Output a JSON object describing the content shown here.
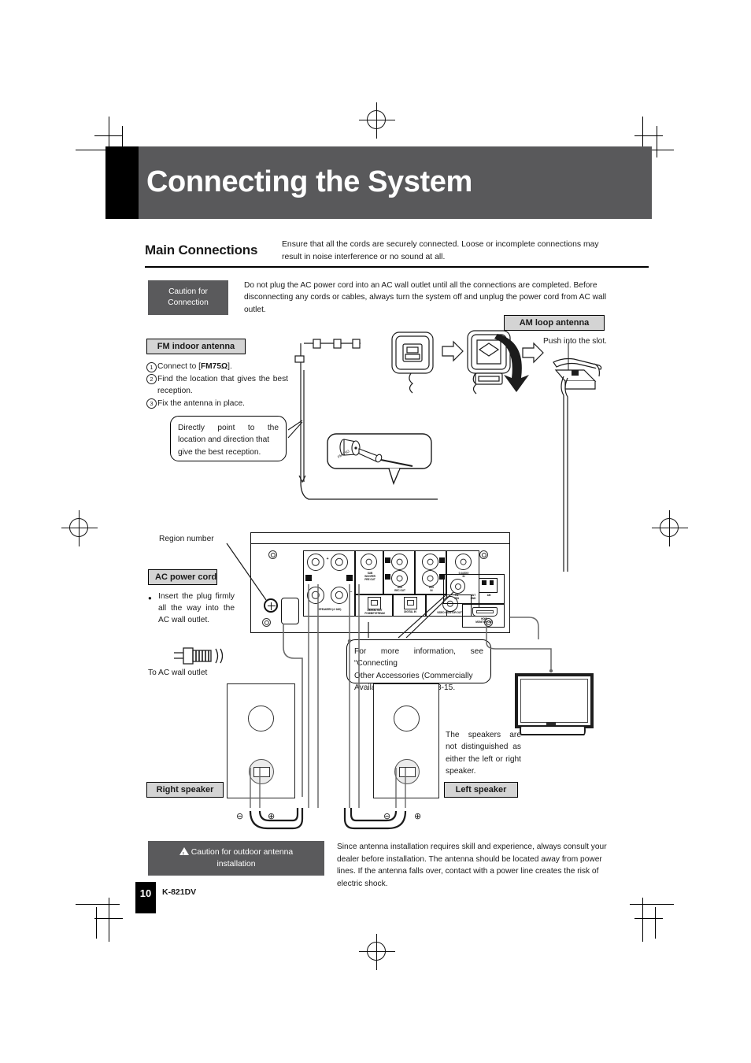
{
  "header": {
    "title": "Connecting the System"
  },
  "main_connections": {
    "heading": "Main Connections",
    "intro": "Ensure that all the cords are securely connected. Loose or incomplete connections may result in noise interference or no sound at all."
  },
  "caution_connection": {
    "label_line1": "Caution for",
    "label_line2": "Connection",
    "text": "Do not plug the AC power cord into an AC wall outlet until all the connections are completed. Before disconnecting any cords or cables, always turn the system off and unplug the power cord from AC wall outlet."
  },
  "fm_antenna": {
    "chip": "FM indoor antenna",
    "step1_pre": "Connect to [",
    "step1_bold": "FM75Ω",
    "step1_post": "].",
    "step2": "Find the location that gives the best reception.",
    "step3": "Fix the antenna in place.",
    "callout_line1": "Directly point to the",
    "callout_line2": "location and direction that",
    "callout_line3": "give the best reception.",
    "connector_label": "FM 75Ω"
  },
  "am_antenna": {
    "chip": "AM loop antenna",
    "push_note": "Push into the slot."
  },
  "ac_power": {
    "region_label": "Region number",
    "chip": "AC power cord",
    "note": "Insert the plug firmly all the way into the AC wall outlet.",
    "outlet_label": "To AC wall outlet"
  },
  "info_callout": {
    "line1": "For more information, see “Connecting",
    "line2": "Other Accessories (Commercially",
    "line3": "Available Units)” on P.13-15."
  },
  "speakers": {
    "right_chip": "Right speaker",
    "left_chip": "Left speaker",
    "note": "The speakers are not distinguished as either the left or right speaker.",
    "minus": "⊖",
    "plus": "⊕"
  },
  "rear_panel": {
    "labels": {
      "speakers": "SPEAKERS (4~16Ω)",
      "subwoofer_l1": "SUB",
      "subwoofer_l2": "WOOFER",
      "subwoofer_l3": "PRE OUT",
      "aux_rec_l1": "AUX",
      "aux_rec_l2": "REC OUT",
      "aux_in_l1": "AUX",
      "aux_in_l2": "IN",
      "d_audio_l1": "D.AUDIO",
      "d_audio_l2": "IN",
      "digital_out_l1": "DIGITAL OUT",
      "digital_out_l2": "PCM/BITSTREAM",
      "digital_in": "DIGITAL IN",
      "video_monitor_out": "VIDEO MONITOR OUT",
      "fm_l1": "FM",
      "fm_l2": "75Ω",
      "ant_gnd_l1": "ANT",
      "ant_gnd_l2": "GND",
      "am": "AM",
      "hdmi_l1": "HDMI",
      "hdmi_l2": "MONITOR OUT",
      "ch_r": "R",
      "ch_l": "L",
      "plus": "+",
      "minus": "−"
    }
  },
  "caution_outdoor": {
    "label_line1": "Caution for outdoor antenna",
    "label_line2": "installation",
    "text": "Since antenna installation requires skill and experience, always consult your dealer before installation. The antenna should be located away from power lines. If the antenna falls over, contact with a power line creates the risk of electric shock."
  },
  "footer": {
    "page_number": "10",
    "model": "K-821DV"
  },
  "colors": {
    "header_bar": "#59595b",
    "header_black": "#000000",
    "chip_fill": "#d4d4d4",
    "caution_fill": "#5a5a5c"
  }
}
